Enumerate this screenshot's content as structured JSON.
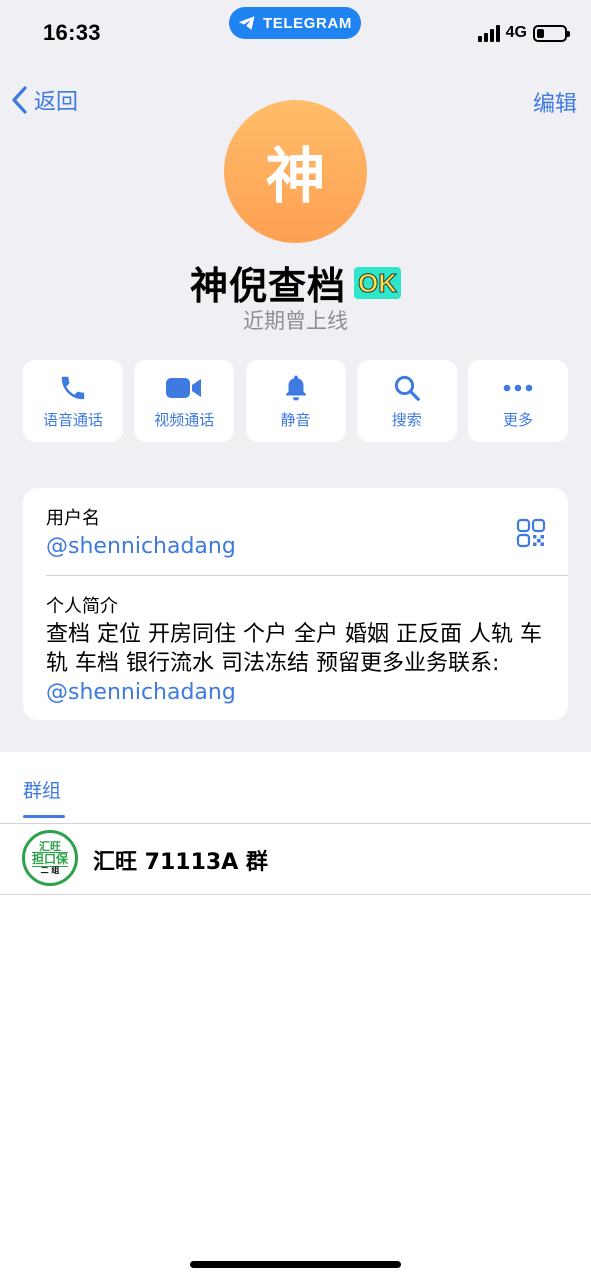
{
  "status_bar": {
    "time": "16:33",
    "pill_label": "TELEGRAM",
    "network": "4G"
  },
  "nav": {
    "back_label": "返回",
    "edit_label": "编辑"
  },
  "profile": {
    "avatar_letter": "神",
    "name": "神倪查档",
    "badge": "OK",
    "last_seen": "近期曾上线"
  },
  "actions": [
    {
      "label": "语音通话",
      "icon": "phone-icon"
    },
    {
      "label": "视频通话",
      "icon": "video-icon"
    },
    {
      "label": "静音",
      "icon": "bell-icon"
    },
    {
      "label": "搜索",
      "icon": "search-icon"
    },
    {
      "label": "更多",
      "icon": "more-icon"
    }
  ],
  "info": {
    "username_label": "用户名",
    "username": "@shennichadang",
    "bio_label": "个人简介",
    "bio_text": "查档 定位 开房同住 个户 全户 婚姻 正反面 人轨 车轨 车档 银行流水 司法冻结 预留更多业务联系: ",
    "bio_link": "@shennichadang"
  },
  "groups": {
    "header": "群组",
    "items": [
      {
        "avatar_line1": "汇旺",
        "avatar_line2": "担口保",
        "avatar_line3": "二 组",
        "name": "汇旺 71113A 群"
      }
    ]
  },
  "colors": {
    "accent": "#3f7ae0",
    "background": "#efeff4",
    "avatar_gradient_top": "#ffbd6a",
    "avatar_gradient_bottom": "#fea052",
    "group_badge": "#2ca24a"
  }
}
